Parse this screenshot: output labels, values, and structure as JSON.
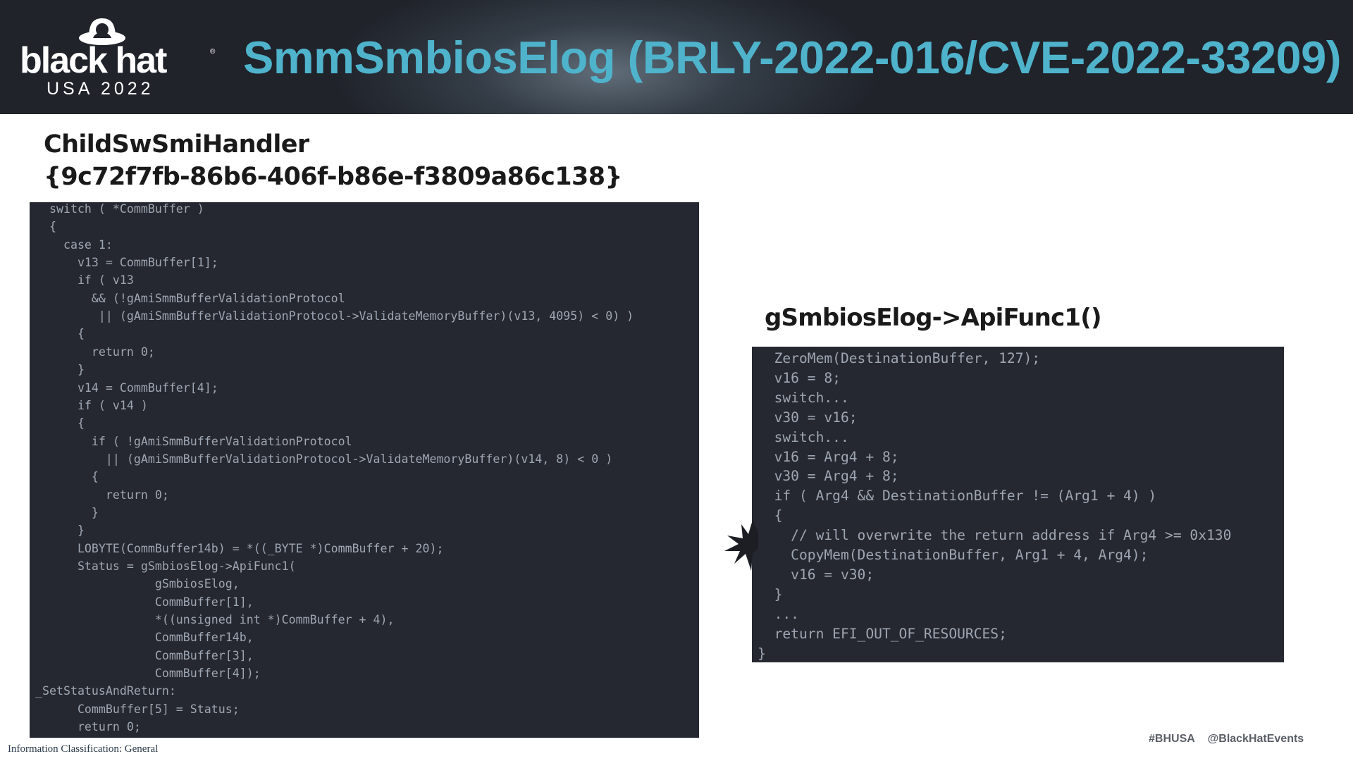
{
  "header": {
    "logo_text": "black hat",
    "logo_sub": "USA 2022",
    "title": "SmmSmbiosElog (BRLY-2022-016/CVE-2022-33209)"
  },
  "left_panel": {
    "heading_line1": "ChildSwSmiHandler",
    "heading_line2": "{9c72f7fb-86b6-406f-b86e-f3809a86c138}",
    "code": [
      "  switch ( *CommBuffer )",
      "  {",
      "    case 1:",
      "      v13 = CommBuffer[1];",
      "      if ( v13",
      "        && (!gAmiSmmBufferValidationProtocol",
      "         || (gAmiSmmBufferValidationProtocol->ValidateMemoryBuffer)(v13, 4095) < 0) )",
      "      {",
      "        return 0;",
      "      }",
      "      v14 = CommBuffer[4];",
      "      if ( v14 )",
      "      {",
      "        if ( !gAmiSmmBufferValidationProtocol",
      "          || (gAmiSmmBufferValidationProtocol->ValidateMemoryBuffer)(v14, 8) < 0 )",
      "        {",
      "          return 0;",
      "        }",
      "      }",
      "      LOBYTE(CommBuffer14b) = *((_BYTE *)CommBuffer + 20);",
      "      Status = gSmbiosElog->ApiFunc1(",
      "                 gSmbiosElog,",
      "                 CommBuffer[1],",
      "                 *((unsigned int *)CommBuffer + 4),",
      "                 CommBuffer14b,",
      "                 CommBuffer[3],",
      "                 CommBuffer[4]);",
      "_SetStatusAndReturn:",
      "      CommBuffer[5] = Status;",
      "      return 0;"
    ]
  },
  "right_panel": {
    "heading": "gSmbiosElog->ApiFunc1()",
    "code": [
      "  ZeroMem(DestinationBuffer, 127);",
      "  v16 = 8;",
      "  switch...",
      "  v30 = v16;",
      "  switch...",
      "  v16 = Arg4 + 8;",
      "  v30 = Arg4 + 8;",
      "  if ( Arg4 && DestinationBuffer != (Arg1 + 4) )",
      "  {",
      "    // will overwrite the return address if Arg4 >= 0x130",
      "    CopyMem(DestinationBuffer, Arg1 + 4, Arg4);",
      "    v16 = v30;",
      "  }",
      "  ...",
      "  return EFI_OUT_OF_RESOURCES;",
      "}"
    ]
  },
  "footer": {
    "classification": "Information Classification: General",
    "hashtag": "#BHUSA",
    "handle": "@BlackHatEvents"
  },
  "colors": {
    "header_bg": "#20232a",
    "title": "#4fb3cc",
    "code_bg": "#252830",
    "code_text": "#9fa6b3"
  }
}
